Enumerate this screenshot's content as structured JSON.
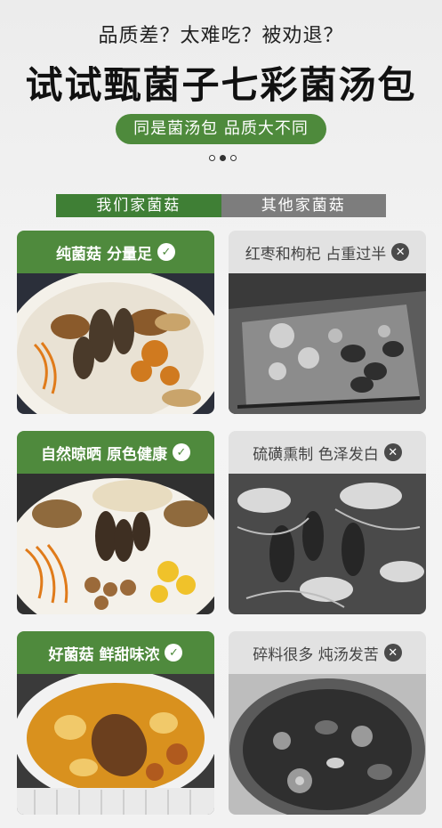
{
  "header": {
    "question_line": "品质差？太难吃？被劝退？",
    "title": "试试甄菌子七彩菌汤包",
    "pill_text": "同是菌汤包  品质大不同"
  },
  "carousel": {
    "dots": 3,
    "active_index": 1
  },
  "tabs": {
    "ours": "我们家菌菇",
    "others": "其他家菌菇"
  },
  "comparisons": [
    {
      "good": "纯菌菇 分量足",
      "bad": "红枣和枸杞 占重过半"
    },
    {
      "good": "自然晾晒 原色健康",
      "bad": "硫磺熏制 色泽发白"
    },
    {
      "good": "好菌菇 鲜甜味浓",
      "bad": "碎料很多 炖汤发苦"
    }
  ],
  "icons": {
    "check": "check-circle-icon",
    "cross": "x-circle-icon"
  },
  "colors": {
    "green": "#4f8a3d",
    "gray_tab": "#7d7d7d"
  }
}
